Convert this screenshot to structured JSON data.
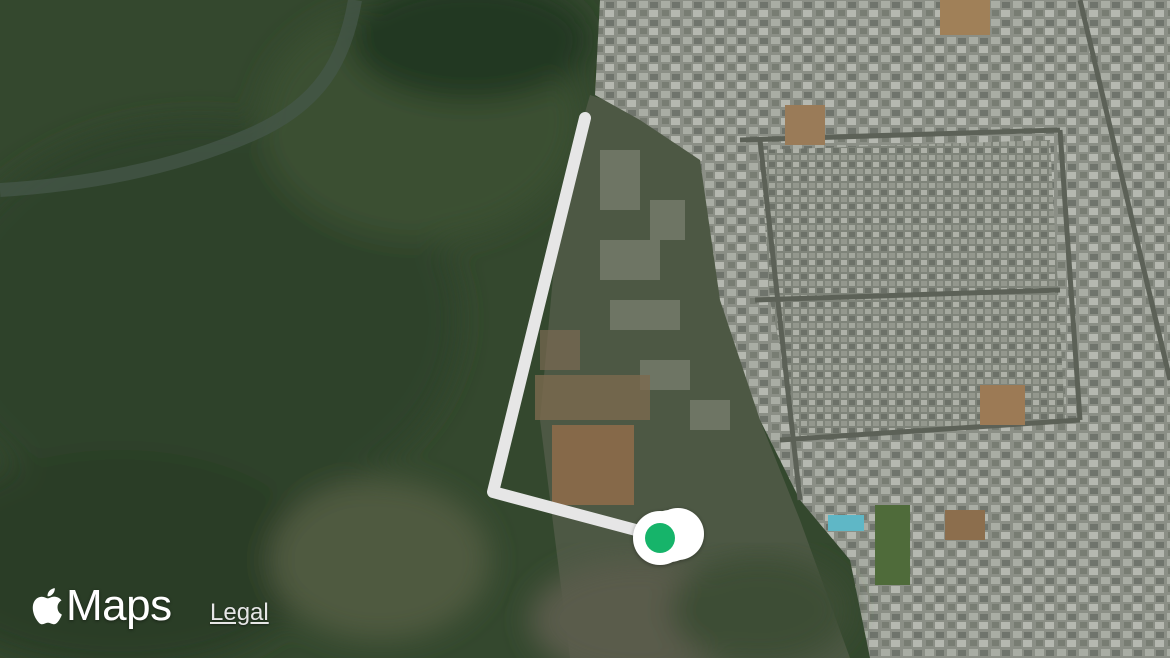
{
  "map": {
    "view": "satellite",
    "route_color": "#e6e6e6",
    "marker_color": "#19b46a",
    "marker_ring_color": "#ffffff"
  },
  "attribution": {
    "brand_label": "Maps",
    "brand_icon": "apple-logo-icon",
    "legal_label": "Legal"
  }
}
